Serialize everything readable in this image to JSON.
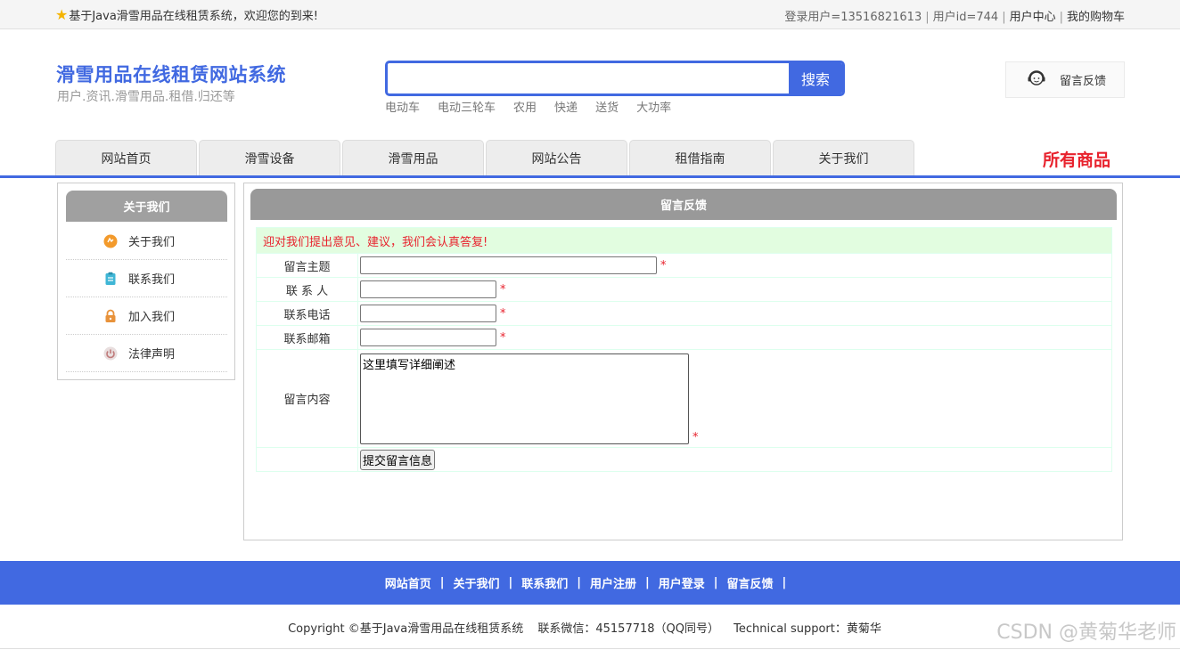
{
  "topbar": {
    "welcome": "基于Java滑雪用品在线租赁系统，欢迎您的到来!",
    "login_user": "登录用户=13516821613",
    "user_id": "用户id=744",
    "user_center": "用户中心",
    "cart": "我的购物车"
  },
  "header": {
    "title": "滑雪用品在线租赁网站系统",
    "slogan": "用户.资讯.滑雪用品.租借.归还等",
    "search_button": "搜索",
    "hotwords": [
      "电动车",
      "电动三轮车",
      "农用",
      "快递",
      "送货",
      "大功率"
    ],
    "feedback": "留言反馈"
  },
  "nav": {
    "items": [
      "网站首页",
      "滑雪设备",
      "滑雪用品",
      "网站公告",
      "租借指南",
      "关于我们"
    ],
    "all_goods": "所有商品"
  },
  "sidebar": {
    "title": "关于我们",
    "items": [
      {
        "label": "关于我们",
        "icon": "orange-circle-icon",
        "color": "#f39a2b"
      },
      {
        "label": "联系我们",
        "icon": "clipboard-icon",
        "color": "#3fb6d6"
      },
      {
        "label": "加入我们",
        "icon": "lock-icon",
        "color": "#e8923a"
      },
      {
        "label": "法律声明",
        "icon": "power-icon",
        "color": "#c07a7a"
      }
    ]
  },
  "main": {
    "title": "留言反馈",
    "notice": "迎对我们提出意见、建议，我们会认真答复!",
    "fields": {
      "subject_label": "留言主题",
      "contact_label": "联 系 人",
      "phone_label": "联系电话",
      "email_label": "联系邮箱",
      "content_label": "留言内容",
      "content_value": "这里填写详细阐述",
      "required_mark": "*"
    },
    "submit": "提交留言信息"
  },
  "footer": {
    "links": [
      "网站首页",
      "关于我们",
      "联系我们",
      "用户注册",
      "用户登录",
      "留言反馈"
    ],
    "separator": "|",
    "copyright": "Copyright ©基于Java滑雪用品在线租赁系统",
    "wechat": "联系微信：45157718（QQ同号）",
    "support": "Technical support：黄菊华"
  },
  "watermark": "CSDN @黄菊华老师",
  "colors": {
    "brand": "#4169e1",
    "accent_red": "#e8222d",
    "notice_bg": "#e2fde0"
  }
}
